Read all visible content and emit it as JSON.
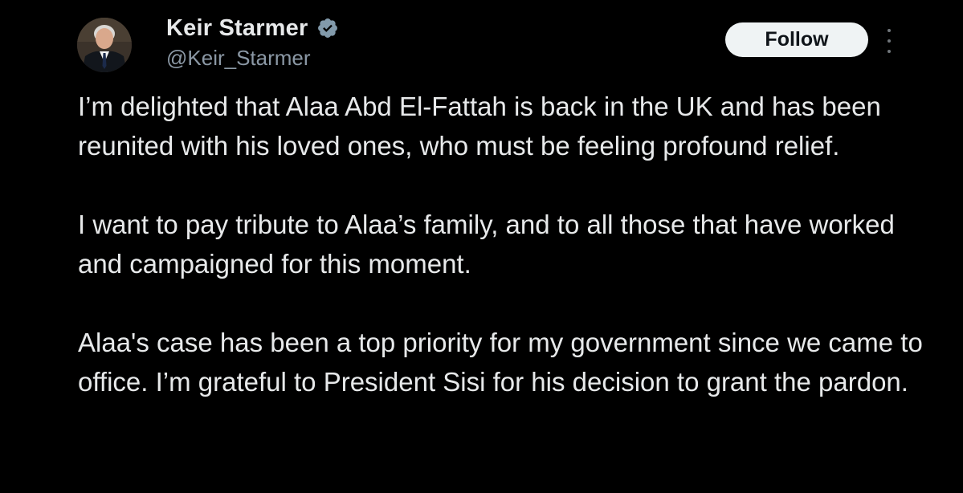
{
  "author": {
    "display_name": "Keir Starmer",
    "handle": "@Keir_Starmer",
    "verified": true,
    "avatar_icon": "profile-photo"
  },
  "actions": {
    "follow_label": "Follow",
    "more_icon": "more-vertical-icon"
  },
  "tweet": {
    "paragraphs": [
      "I’m delighted that Alaa Abd El-Fattah is back in the UK and has been reunited with his loved ones, who must be feeling profound relief.",
      "I want to pay tribute to Alaa’s family, and to all those that have worked and campaigned for this moment.",
      "Alaa's case has been a top priority for my government since we came to office. I’m grateful to President Sisi for his decision to grant the pardon."
    ]
  },
  "colors": {
    "background": "#000000",
    "text_primary": "#e7e9ea",
    "text_secondary": "#8b98a5",
    "follow_bg": "#eff3f4",
    "verified_badge": "#829aab"
  }
}
